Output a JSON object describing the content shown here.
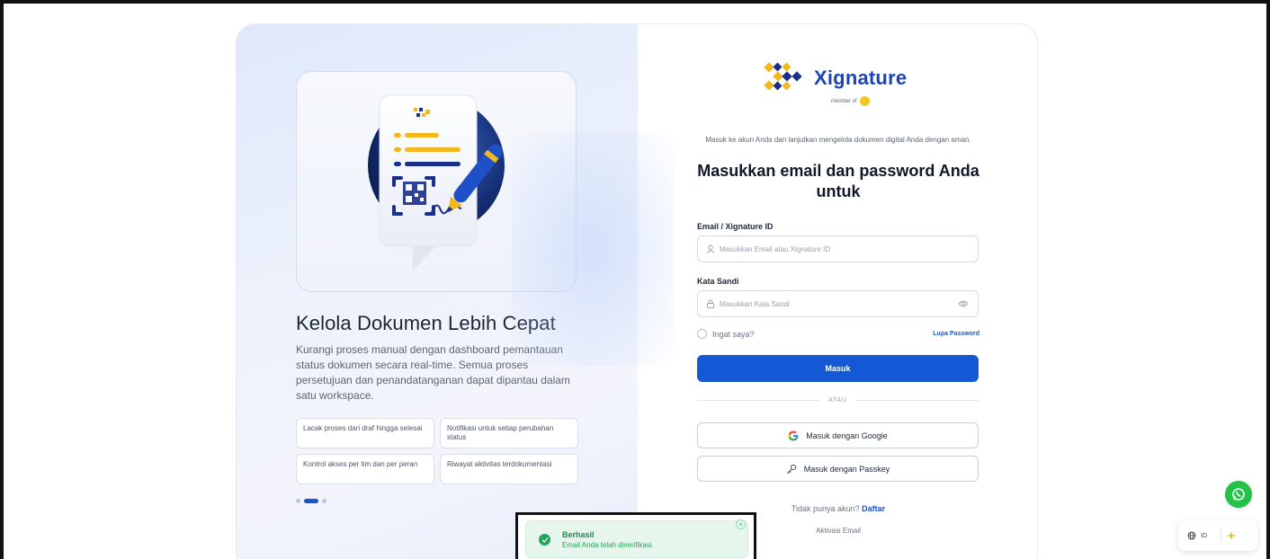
{
  "hero": {
    "title": "Kelola Dokumen Lebih Cepat",
    "description": "Kurangi proses manual dengan dashboard pemantauan status dokumen secara real-time. Semua proses persetujuan dan penandatanganan dapat dipantau dalam satu workspace.",
    "features": [
      "Lacak proses dari draf hingga selesai",
      "Notifikasi untuk setiap perubahan status",
      "Kontrol akses per tim dan per peran",
      "Riwayat aktivitas terdokumentasi"
    ],
    "carousel_active_index": 1
  },
  "brand": {
    "name": "Xignature",
    "member_of": "member of",
    "primary_color": "#1558d6",
    "logo_gold": "#f2b81e",
    "logo_navy": "#1a2f8a"
  },
  "login": {
    "subtitle": "Masuk ke akun Anda dan lanjutkan mengelola dokumen digital Anda dengan aman.",
    "title": "Masukkan email dan password Anda untuk",
    "email_label": "Email / Xignature ID",
    "email_placeholder": "Masukkan Email atau Xignature ID",
    "password_label": "Kata Sandi",
    "password_placeholder": "Masukkan Kata Sandi",
    "remember_label": "Ingat saya?",
    "forgot_label": "Lupa Password",
    "submit_label": "Masuk",
    "divider_label": "ATAU",
    "google_label": "Masuk dengan Google",
    "passkey_label": "Masuk dengan Passkey",
    "no_account_text": "Tidak punya akun?",
    "signup_label": "Daftar",
    "activate_label": "Aktivasi Email"
  },
  "toast": {
    "title": "Berhasil",
    "message": "Email Anda telah diverifikasi.",
    "color": "#23a45a"
  },
  "language": {
    "current": "ID"
  }
}
